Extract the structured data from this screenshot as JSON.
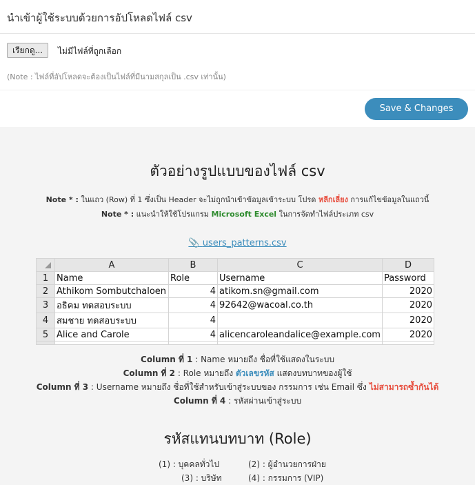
{
  "panel": {
    "title": "นำเข้าผู้ใช้ระบบด้วยการอัปโหลดไฟล์ csv",
    "file_button": "เรียกดู...",
    "file_status": "ไม่มีไฟล์ที่ถูกเลือก",
    "note": "(Note : ไฟล์ที่อัปโหลดจะต้องเป็นไฟล์ที่มีนามสกุลเป็น .csv เท่านั้น)",
    "save_button": "Save & Changes"
  },
  "example": {
    "title": "ตัวอย่างรูปแบบของไฟล์ csv",
    "note1_label": "Note * :",
    "note1_pre": " ในแถว (Row) ที่ 1 ซึ่งเป็น Header จะไม่ถูกนำเข้าข้อมูลเข้าระบบ โปรด ",
    "note1_highlight": "หลีกเลี่ยง",
    "note1_post": " การแก้ไขข้อมูลในแถวนี้",
    "note2_label": "Note * :",
    "note2_pre": " แนะนำให้ใช้โปรแกรม ",
    "note2_highlight": "Microsoft Excel",
    "note2_post": " ในการจัดทำไฟล์ประเภท csv",
    "download_link": "users_patterns.csv"
  },
  "sheet": {
    "col_headers": [
      "A",
      "B",
      "C",
      "D"
    ],
    "rows": [
      {
        "n": "1",
        "a": "Name",
        "b": "Role",
        "c": "Username",
        "d": "Password"
      },
      {
        "n": "2",
        "a": "Athikom Sombutchaloen",
        "b": "4",
        "c": "atikom.sn@gmail.com",
        "d": "2020"
      },
      {
        "n": "3",
        "a": "อธิคม ทดสอบระบบ",
        "b": "4",
        "c": "92642@wacoal.co.th",
        "d": "2020"
      },
      {
        "n": "4",
        "a": "สมชาย ทดสอบระบบ",
        "b": "4",
        "c": "",
        "d": "2020"
      },
      {
        "n": "5",
        "a": "Alice and Carole",
        "b": "4",
        "c": "alicencaroleandalice@example.com",
        "d": "2020"
      }
    ]
  },
  "columns": {
    "c1_label": "Column ที่ 1",
    "c1_text": " : Name หมายถึง ชื่อที่ใช้แสดงในระบบ",
    "c2_label": "Column ที่ 2",
    "c2_pre": " : Role หมายถึง ",
    "c2_highlight": "ตัวเลขรหัส",
    "c2_post": " แสดงบทบาทของผู้ใช้",
    "c3_label": "Column ที่ 3",
    "c3_pre": " : Username หมายถึง ชื่อที่ใช้สำหรับเข้าสู่ระบบของ กรรมการ เช่น Email ซึ่ง ",
    "c3_highlight": "ไม่สามารถซ้ำกันได้",
    "c4_label": "Column ที่ 4",
    "c4_text": " : รหัสผ่านเข้าสู่ระบบ"
  },
  "roles": {
    "title": "รหัสแทนบทบาท (Role)",
    "r1": "(1) : บุคคลทั่วไป",
    "r2": "(2) : ผู้อำนวยการฝ่าย",
    "r3": "(3) : บริษัท",
    "r4": "(4) : กรรมการ (VIP)"
  }
}
